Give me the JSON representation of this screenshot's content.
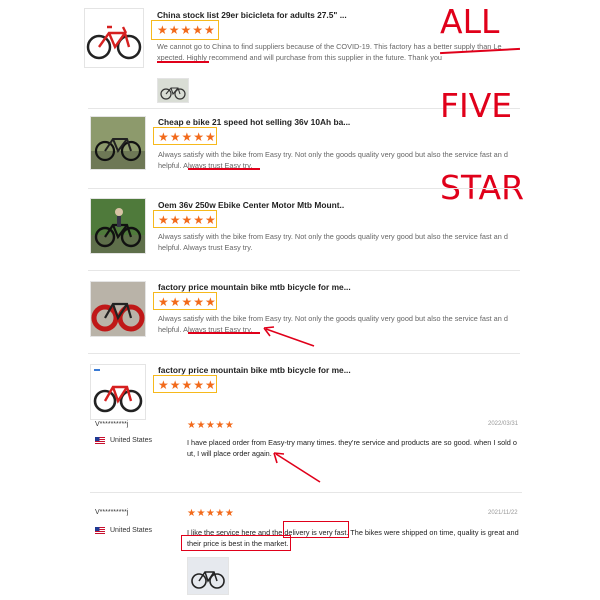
{
  "colors": {
    "star": "#f26a1b",
    "highlight_box": "#f6b91c",
    "annotation_red": "#e0001a"
  },
  "annotation": {
    "line1": "ALL",
    "line2": "FIVE",
    "line3": "STAR"
  },
  "products": [
    {
      "title": "China stock list 29er bicicleta for adults 27.5\" ...",
      "rating": "★★★★★",
      "review": "We cannot go to China to find suppliers because of the COVID-19.  This factory has a better supply than Le xpected. Highly recommend and will purchase from this supplier in the future. Thank you"
    },
    {
      "title": "Cheap e bike 21 speed hot selling 36v 10Ah ba...",
      "rating": "★★★★★",
      "review": "Always satisfy with the bike from Easy try. Not only the goods quality very good but also the service fast an d helpful. Always trust Easy try."
    },
    {
      "title": "Oem 36v 250w Ebike Center Motor Mtb Mount..",
      "rating": "★★★★★",
      "review": "Always satisfy with the bike from Easy try. Not only the goods quality very good but also the service fast an d helpful. Always trust Easy try."
    },
    {
      "title": "factory price mountain bike mtb bicycle for me...",
      "rating": "★★★★★",
      "review": "Always satisfy with the bike from Easy try. Not only the goods quality very good but also the service fast an d helpful. Always trust Easy try."
    },
    {
      "title": "factory price mountain bike mtb bicycle for me...",
      "rating": "★★★★★"
    }
  ],
  "buyer_reviews": [
    {
      "user": "V**********j",
      "country": "United States",
      "rating": "★★★★★",
      "date": "2022/03/31",
      "text": "I have placed order from Easy-try many times. they're service and products are so good. when I sold o ut, I will place order again."
    },
    {
      "user": "V**********j",
      "country": "United States",
      "rating": "★★★★★",
      "date": "2021/11/22",
      "text": "I like the service here and the delivery is very fast. The bikes were shipped on time, quality is great and their price is best in the market."
    }
  ]
}
